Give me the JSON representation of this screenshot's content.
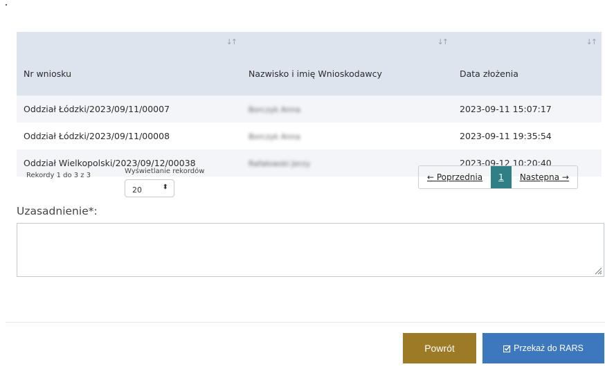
{
  "table": {
    "columns": [
      {
        "label": "Nr wniosku",
        "sort_icon": "sort-icon"
      },
      {
        "label": "Nazwisko i imię Wnioskodawcy",
        "sort_icon": "sort-icon"
      },
      {
        "label": "Data złożenia",
        "sort_icon": "sort-icon"
      }
    ],
    "rows": [
      {
        "number": "Oddział Łódzki/2023/09/11/00007",
        "applicant": "Borczyk Anna",
        "date": "2023-09-11 15:07:17"
      },
      {
        "number": "Oddział Łódzki/2023/09/11/00008",
        "applicant": "Borczyk Anna",
        "date": "2023-09-11 19:35:54"
      },
      {
        "number": "Oddział Wielkopolski/2023/09/12/00038",
        "applicant": "Rafałowski Jerzy",
        "date": "2023-09-12 10:20:40"
      }
    ]
  },
  "info": {
    "text": "Rekordy 1 do 3 z 3"
  },
  "page_length": {
    "label": "Wyświetlanie rekordów",
    "value": "20"
  },
  "pagination": {
    "prev": "← Poprzednia",
    "current": "1",
    "next": "Następna →"
  },
  "reason": {
    "label": "Uzasadnienie*:",
    "value": ""
  },
  "buttons": {
    "back": "Powrót",
    "submit": "Przekaż do RARS",
    "submit_icon": "check-square-icon"
  },
  "colors": {
    "header_bg": "#dde4ee",
    "pager_active": "#2f7f86",
    "back_button": "#9c7a26",
    "submit_button": "#3d77bd"
  }
}
